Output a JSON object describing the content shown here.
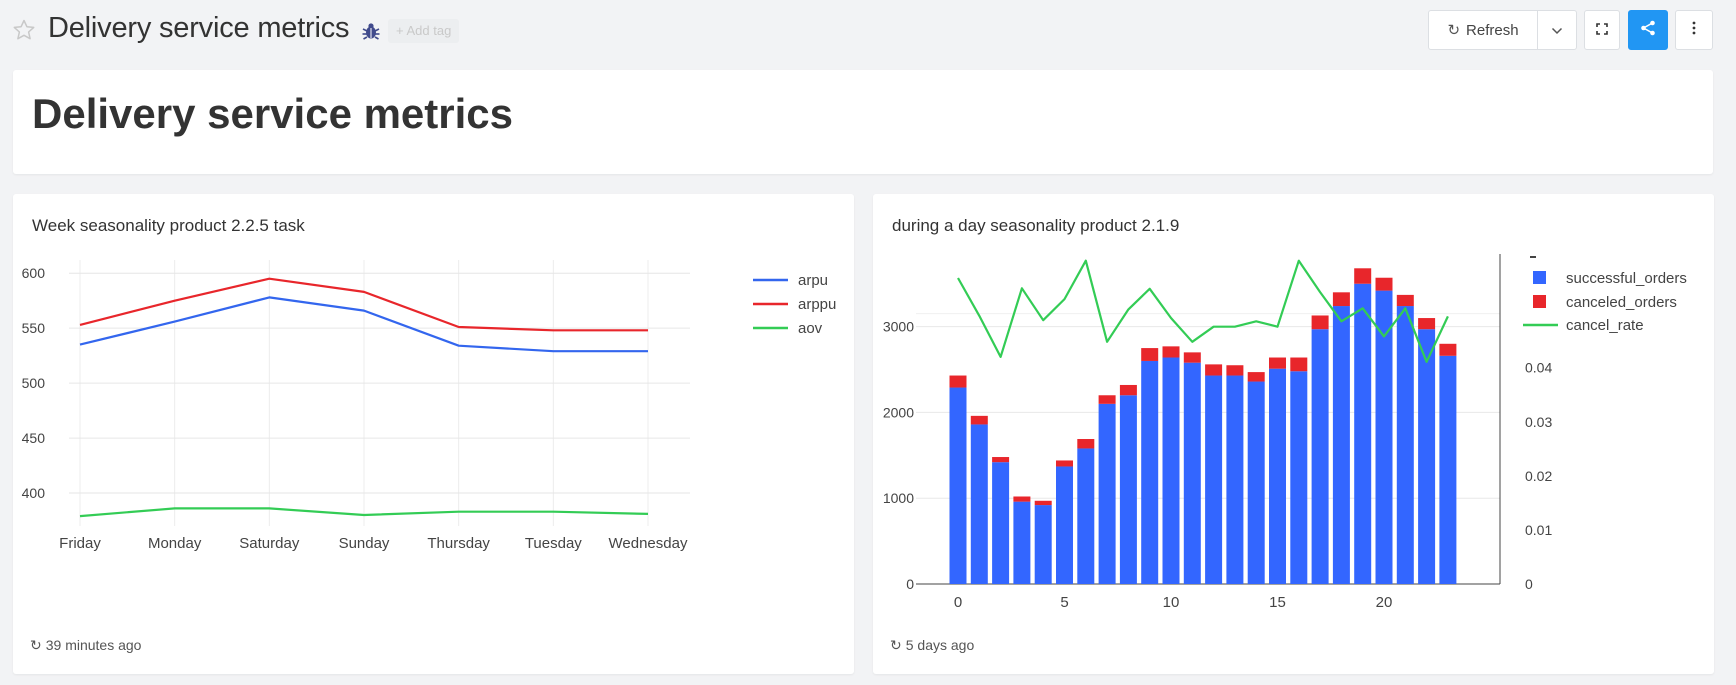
{
  "header": {
    "title": "Delivery service metrics",
    "star_icon": "star-outline-icon",
    "bug_icon": "bug-icon",
    "add_tag_label": "+ Add tag",
    "refresh_label": "Refresh",
    "refresh_icon": "refresh-icon",
    "caret_icon": "chevron-down-icon",
    "fullscreen_icon": "fullscreen-icon",
    "share_icon": "share-icon",
    "more_icon": "more-vertical-icon",
    "share_color": "#2196f3"
  },
  "text_widget": {
    "heading": "Delivery service metrics"
  },
  "widgets": [
    {
      "title": "Week seasonality product 2.2.5 task",
      "updated": "39 minutes ago"
    },
    {
      "title": "during a day seasonality product 2.1.9",
      "updated": "5 days ago"
    }
  ],
  "chart_data": [
    {
      "type": "line",
      "title": "Week seasonality product 2.2.5 task",
      "categories": [
        "Friday",
        "Monday",
        "Saturday",
        "Sunday",
        "Thursday",
        "Tuesday",
        "Wednesday"
      ],
      "y_ticks": [
        "400",
        "450",
        "500",
        "550",
        "600"
      ],
      "ylim": [
        370,
        612
      ],
      "grid": true,
      "legend_position": "right",
      "series": [
        {
          "name": "arpu",
          "color": "#3366ee",
          "values": [
            535,
            556,
            578,
            566,
            534,
            529,
            529
          ]
        },
        {
          "name": "arppu",
          "color": "#e8262b",
          "values": [
            553,
            575,
            595,
            583,
            551,
            548,
            548
          ]
        },
        {
          "name": "aov",
          "color": "#33cc55",
          "values": [
            379,
            386,
            386,
            380,
            383,
            383,
            381
          ]
        }
      ]
    },
    {
      "type": "bar",
      "stacked": true,
      "title": "during a day seasonality product 2.1.9",
      "x": [
        0,
        1,
        2,
        3,
        4,
        5,
        6,
        7,
        8,
        9,
        10,
        11,
        12,
        13,
        14,
        15,
        16,
        17,
        18,
        19,
        20,
        21,
        22,
        23
      ],
      "x_ticks": [
        "0",
        "5",
        "10",
        "15",
        "20"
      ],
      "y_ticks": [
        "0",
        "1000",
        "2000",
        "3000"
      ],
      "ylim": [
        0,
        3800
      ],
      "y2_ticks": [
        "0",
        "0.01",
        "0.02",
        "0.03",
        "0.04"
      ],
      "y2lim": [
        0,
        0.0603
      ],
      "grid": true,
      "legend_position": "right",
      "series": [
        {
          "name": "successful_orders",
          "color": "#3366ff",
          "axis": "y",
          "values": [
            2290,
            1860,
            1420,
            960,
            920,
            1370,
            1580,
            2100,
            2200,
            2600,
            2640,
            2580,
            2430,
            2430,
            2360,
            2510,
            2480,
            2970,
            3240,
            3500,
            3420,
            3240,
            2970,
            2660
          ]
        },
        {
          "name": "canceled_orders",
          "color": "#e8262b",
          "axis": "y",
          "values": [
            140,
            100,
            60,
            60,
            50,
            70,
            110,
            100,
            120,
            150,
            130,
            120,
            130,
            120,
            110,
            130,
            160,
            160,
            160,
            180,
            150,
            130,
            130,
            140
          ]
        },
        {
          "name": "cancel_rate",
          "color": "#33cc55",
          "axis": "y2",
          "type": "line",
          "values": [
            0.0566,
            0.0496,
            0.042,
            0.0547,
            0.0488,
            0.0527,
            0.0598,
            0.0448,
            0.0508,
            0.0546,
            0.0492,
            0.0448,
            0.0476,
            0.0476,
            0.0486,
            0.0476,
            0.0598,
            0.054,
            0.0486,
            0.051,
            0.0458,
            0.051,
            0.0411,
            0.0495
          ]
        }
      ]
    }
  ]
}
